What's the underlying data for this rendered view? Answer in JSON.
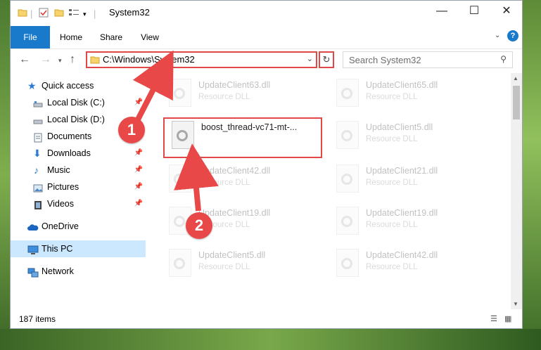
{
  "window": {
    "title": "System32"
  },
  "ribbon": {
    "tabs": [
      "File",
      "Home",
      "Share",
      "View"
    ]
  },
  "address": {
    "path": "C:\\Windows\\System32"
  },
  "search": {
    "placeholder": "Search System32"
  },
  "nav": [
    {
      "label": "Quick access",
      "icon": "star-icon"
    },
    {
      "label": "Local Disk (C:)",
      "icon": "drive-icon",
      "pinned": true
    },
    {
      "label": "Local Disk (D:)",
      "icon": "drive-icon"
    },
    {
      "label": "Documents",
      "icon": "documents-icon",
      "pinned": true
    },
    {
      "label": "Downloads",
      "icon": "download-icon",
      "pinned": true
    },
    {
      "label": "Music",
      "icon": "music-icon",
      "pinned": true
    },
    {
      "label": "Pictures",
      "icon": "pictures-icon",
      "pinned": true
    },
    {
      "label": "Videos",
      "icon": "videos-icon",
      "pinned": true
    },
    {
      "label": "OneDrive",
      "icon": "cloud-icon"
    },
    {
      "label": "This PC",
      "icon": "computer-icon",
      "selected": true
    },
    {
      "label": "Network",
      "icon": "network-icon"
    }
  ],
  "files": [
    {
      "name": "UpdateClient63.dll",
      "type": "Resource DLL"
    },
    {
      "name": "UpdateClient65.dll",
      "type": "Resource DLL"
    },
    {
      "name": "boost_thread-vc71-mt-...",
      "type": ""
    },
    {
      "name": "UpdateClient5.dll",
      "type": "Resource DLL"
    },
    {
      "name": "UpdateClient42.dll",
      "type": "Resource DLL"
    },
    {
      "name": "UpdateClient21.dll",
      "type": "Resource DLL"
    },
    {
      "name": "UpdateClient19.dll",
      "type": "Resource DLL"
    },
    {
      "name": "UpdateClient19.dll",
      "type": "Resource DLL"
    },
    {
      "name": "UpdateClient5.dll",
      "type": "Resource DLL"
    },
    {
      "name": "UpdateClient42.dll",
      "type": "Resource DLL"
    }
  ],
  "status": {
    "count": "187 items"
  },
  "annotations": {
    "step1": "1",
    "step2": "2"
  },
  "colors": {
    "accent": "#1979ca",
    "highlight": "#e04848",
    "selected": "#cce8ff"
  }
}
